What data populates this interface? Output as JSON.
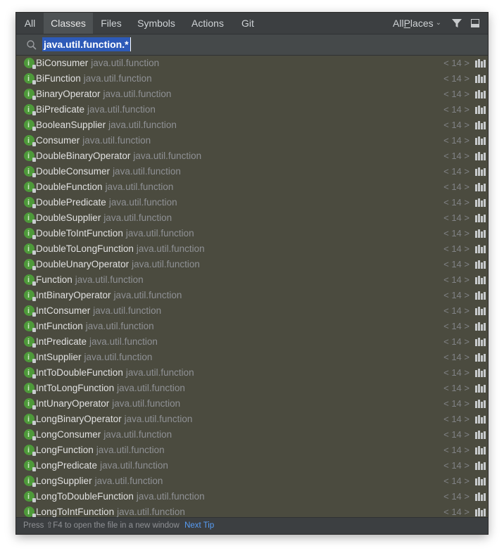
{
  "tabs": [
    {
      "label": "All"
    },
    {
      "label": "Classes"
    },
    {
      "label": "Files"
    },
    {
      "label": "Symbols"
    },
    {
      "label": "Actions"
    },
    {
      "label": "Git"
    }
  ],
  "selected_tab": "Classes",
  "places": {
    "prefix": "All ",
    "underlined": "P",
    "suffix": "laces"
  },
  "search": {
    "value": "java.util.function.*"
  },
  "results": [
    {
      "name": "BiConsumer",
      "package": "java.util.function",
      "jdk": "< 14 >"
    },
    {
      "name": "BiFunction",
      "package": "java.util.function",
      "jdk": "< 14 >"
    },
    {
      "name": "BinaryOperator",
      "package": "java.util.function",
      "jdk": "< 14 >"
    },
    {
      "name": "BiPredicate",
      "package": "java.util.function",
      "jdk": "< 14 >"
    },
    {
      "name": "BooleanSupplier",
      "package": "java.util.function",
      "jdk": "< 14 >"
    },
    {
      "name": "Consumer",
      "package": "java.util.function",
      "jdk": "< 14 >"
    },
    {
      "name": "DoubleBinaryOperator",
      "package": "java.util.function",
      "jdk": "< 14 >"
    },
    {
      "name": "DoubleConsumer",
      "package": "java.util.function",
      "jdk": "< 14 >"
    },
    {
      "name": "DoubleFunction",
      "package": "java.util.function",
      "jdk": "< 14 >"
    },
    {
      "name": "DoublePredicate",
      "package": "java.util.function",
      "jdk": "< 14 >"
    },
    {
      "name": "DoubleSupplier",
      "package": "java.util.function",
      "jdk": "< 14 >"
    },
    {
      "name": "DoubleToIntFunction",
      "package": "java.util.function",
      "jdk": "< 14 >"
    },
    {
      "name": "DoubleToLongFunction",
      "package": "java.util.function",
      "jdk": "< 14 >"
    },
    {
      "name": "DoubleUnaryOperator",
      "package": "java.util.function",
      "jdk": "< 14 >"
    },
    {
      "name": "Function",
      "package": "java.util.function",
      "jdk": "< 14 >"
    },
    {
      "name": "IntBinaryOperator",
      "package": "java.util.function",
      "jdk": "< 14 >"
    },
    {
      "name": "IntConsumer",
      "package": "java.util.function",
      "jdk": "< 14 >"
    },
    {
      "name": "IntFunction",
      "package": "java.util.function",
      "jdk": "< 14 >"
    },
    {
      "name": "IntPredicate",
      "package": "java.util.function",
      "jdk": "< 14 >"
    },
    {
      "name": "IntSupplier",
      "package": "java.util.function",
      "jdk": "< 14 >"
    },
    {
      "name": "IntToDoubleFunction",
      "package": "java.util.function",
      "jdk": "< 14 >"
    },
    {
      "name": "IntToLongFunction",
      "package": "java.util.function",
      "jdk": "< 14 >"
    },
    {
      "name": "IntUnaryOperator",
      "package": "java.util.function",
      "jdk": "< 14 >"
    },
    {
      "name": "LongBinaryOperator",
      "package": "java.util.function",
      "jdk": "< 14 >"
    },
    {
      "name": "LongConsumer",
      "package": "java.util.function",
      "jdk": "< 14 >"
    },
    {
      "name": "LongFunction",
      "package": "java.util.function",
      "jdk": "< 14 >"
    },
    {
      "name": "LongPredicate",
      "package": "java.util.function",
      "jdk": "< 14 >"
    },
    {
      "name": "LongSupplier",
      "package": "java.util.function",
      "jdk": "< 14 >"
    },
    {
      "name": "LongToDoubleFunction",
      "package": "java.util.function",
      "jdk": "< 14 >"
    },
    {
      "name": "LongToIntFunction",
      "package": "java.util.function",
      "jdk": "< 14 >"
    }
  ],
  "footer": {
    "hint": "Press ⇧F4 to open the file in a new window",
    "next_tip": "Next Tip"
  },
  "colors": {
    "panel": "#4b4b3f",
    "selection": "#2d5ab8",
    "class_icon": "#4e9a3a",
    "link": "#589df6"
  },
  "icons": {
    "search": "search-icon",
    "filter": "filter-icon",
    "preview": "preview-panel-icon",
    "class": "class-icon",
    "library": "library-icon"
  }
}
